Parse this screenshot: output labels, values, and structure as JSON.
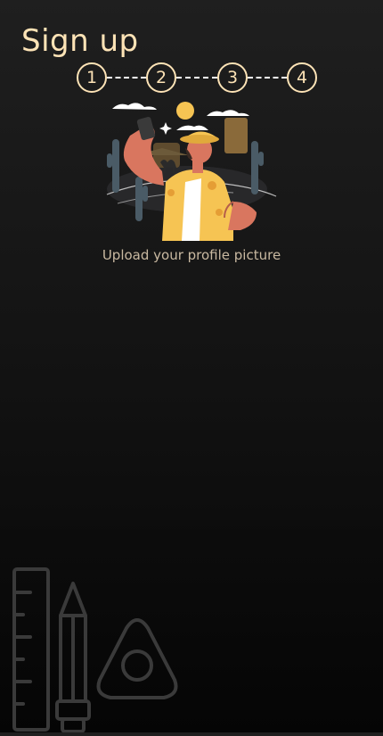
{
  "header": {
    "title": "Sign up"
  },
  "stepper": {
    "steps": [
      {
        "label": "1"
      },
      {
        "label": "2"
      },
      {
        "label": "3"
      },
      {
        "label": "4"
      }
    ]
  },
  "illustration": {
    "icon": "selfie-traveler-illustration"
  },
  "upload": {
    "caption": "Upload your profile picture"
  },
  "decoration": {
    "icons": [
      "ruler-icon",
      "pencil-icon",
      "eraser-icon"
    ]
  },
  "colors": {
    "accent": "#fde3b6",
    "caption": "#c9b9a1",
    "background_top": "#1f1f1f",
    "background_bottom": "#050505"
  }
}
